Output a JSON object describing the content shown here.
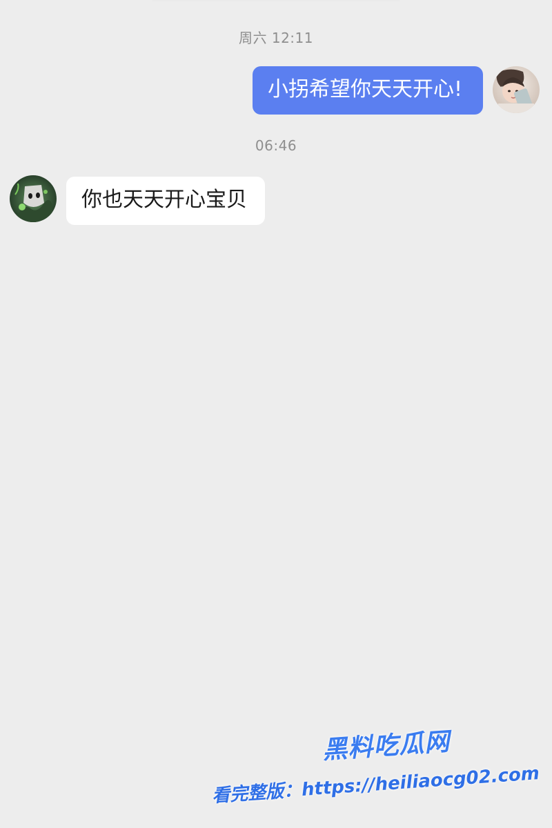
{
  "chat": {
    "messages": [
      {
        "timestamp": "周六 12:11",
        "direction": "outgoing",
        "avatar_icon": "girl-photo-avatar",
        "text": "小拐希望你天天开心!"
      },
      {
        "timestamp": "06:46",
        "direction": "incoming",
        "avatar_icon": "dark-green-character-avatar",
        "text": "你也天天开心宝贝"
      }
    ]
  },
  "watermark": {
    "logo_text": "黑料吃瓜网",
    "url_text": "看完整版：https://heiliaocg02.com"
  },
  "colors": {
    "background": "#ededed",
    "outgoing_bubble": "#5b7ff0",
    "incoming_bubble": "#ffffff",
    "timestamp_text": "#8e8e8e",
    "watermark_blue": "#3a7cf0"
  }
}
